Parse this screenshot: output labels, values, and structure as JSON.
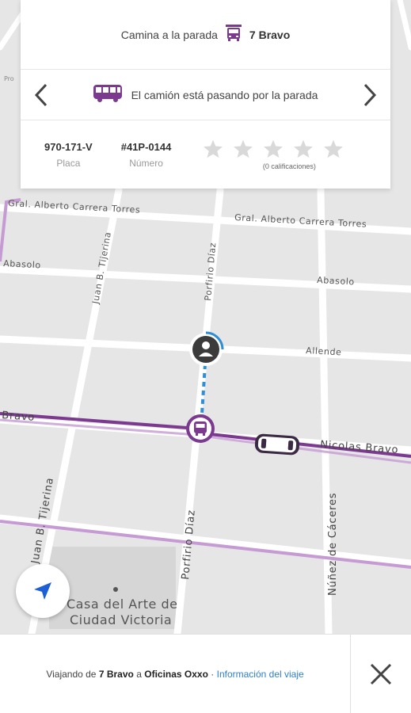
{
  "map": {
    "streets": {
      "carrera_torres_left": "Gral. Alberto Carrera Torres",
      "carrera_torres_right": "Gral. Alberto Carrera Torres",
      "abasolo_left": "Abasolo",
      "abasolo_right": "Abasolo",
      "allende": "Allende",
      "nicolas_bravo": "Nicolas Bravo",
      "nicolas_bravo_left": "Bravo",
      "juan_tijerina": "Juan B. Tijerina",
      "juan_tijerina_lower": "Juan B. Tijerina",
      "porfirio_diaz_upper": "Porfirio Díaz",
      "porfirio_diaz_lower": "Porfirio Díaz",
      "nunez_caceres": "Núñez de Cáceres"
    },
    "poi": {
      "line1": "Casa del Arte de",
      "line2": "Ciudad Victoria"
    }
  },
  "card": {
    "walk_text": "Camina a la parada",
    "stop_name": "7 Bravo",
    "status_text": "El camión está pasando por la parada",
    "plate_value": "970-171-V",
    "plate_label": "Placa",
    "number_value": "#41P-0144",
    "number_label": "Número",
    "rating_count": "(0 calificaciones)",
    "rating_value": 0,
    "rating_max": 5
  },
  "bottom": {
    "traveling_prefix": "Viajando de",
    "from": "7 Bravo",
    "connector": "a",
    "to": "Oficinas Oxxo",
    "separator": "·",
    "trip_info_link": "Información del viaje"
  },
  "colors": {
    "route": "#7b3a8f",
    "route_light": "#c69bd3",
    "walk_path": "#2f8ed8",
    "link": "#2f80c8"
  },
  "icons": {
    "stop": "bus-stop-icon",
    "bus": "bus-icon",
    "prev": "chevron-left-icon",
    "next": "chevron-right-icon",
    "star": "star-icon",
    "locate": "navigation-arrow-icon",
    "close": "close-icon",
    "user": "user-location-icon",
    "vehicle": "bus-vehicle-icon"
  }
}
